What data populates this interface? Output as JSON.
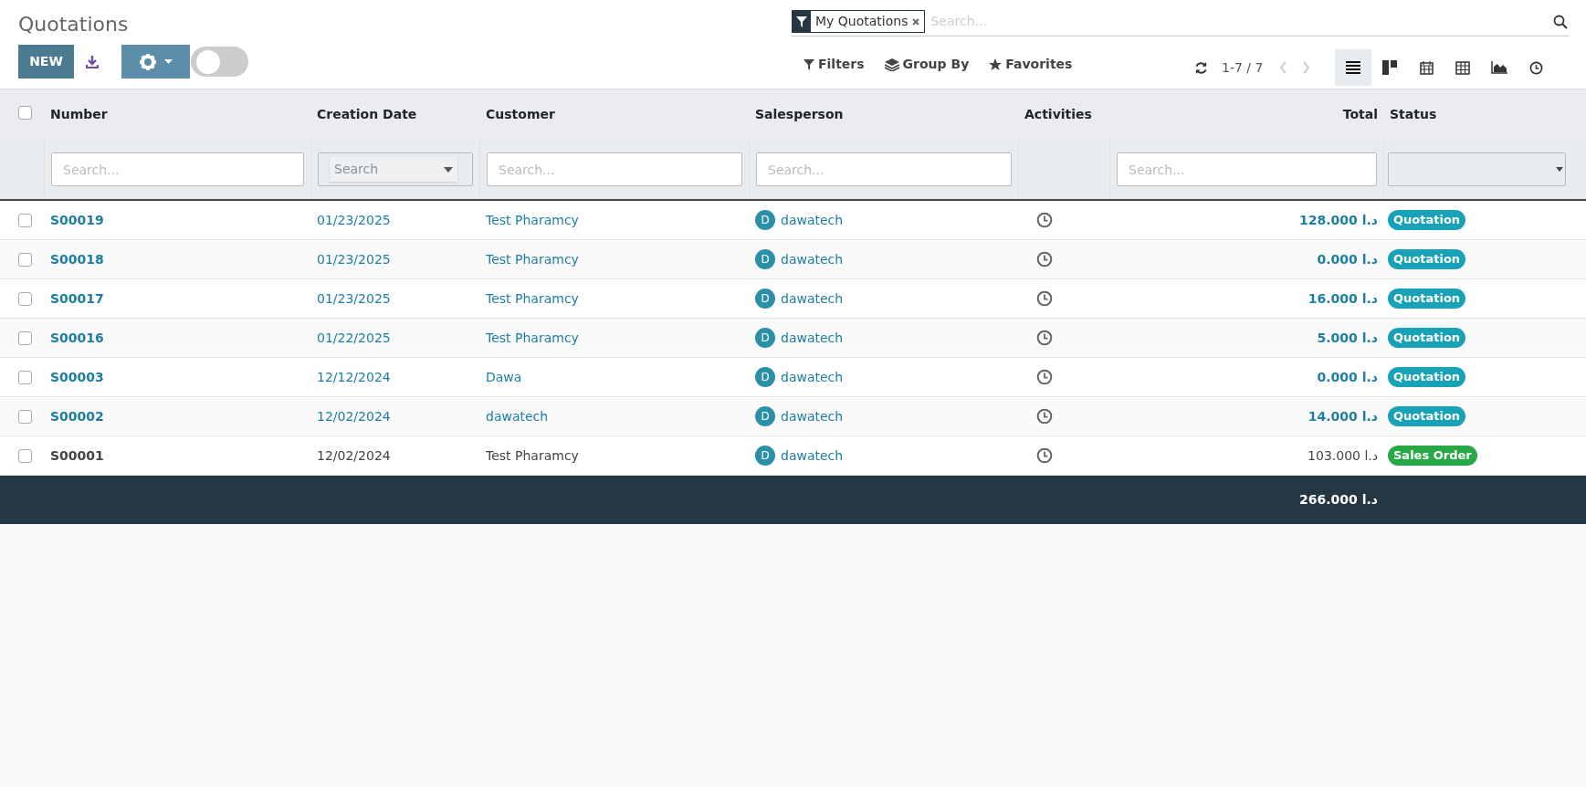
{
  "title": "Quotations",
  "toolbar": {
    "new_button": "NEW",
    "toggle_on": false
  },
  "search": {
    "facet": "My Quotations",
    "placeholder": "Search..."
  },
  "search_options": [
    "Filters",
    "Group By",
    "Favorites"
  ],
  "pager": "1-7 / 7",
  "views": [
    {
      "kind": "list",
      "selected": true
    },
    {
      "kind": "kanban",
      "selected": false
    },
    {
      "kind": "calendar",
      "selected": false
    },
    {
      "kind": "pivot",
      "selected": false
    },
    {
      "kind": "graph",
      "selected": false
    },
    {
      "kind": "activity",
      "selected": false
    }
  ],
  "table": {
    "columns": [
      "Number",
      "Creation Date",
      "Customer",
      "Salesperson",
      "Activities",
      "Total",
      "Status"
    ],
    "all_checked": false,
    "filters": [
      {
        "kind": "text",
        "placeholder": "Search..."
      },
      {
        "kind": "select",
        "placeholder": "Search"
      },
      {
        "kind": "text",
        "placeholder": "Search..."
      },
      {
        "kind": "text",
        "placeholder": "Search..."
      },
      {
        "kind": "none"
      },
      {
        "kind": "text",
        "placeholder": "Search..."
      },
      {
        "kind": "select"
      }
    ],
    "rows": [
      {
        "checked": false,
        "highlighted": true,
        "number": "S00019",
        "date": "01/23/2025",
        "customer": "Test Pharamcy",
        "avatar": "D",
        "salesperson": "dawatech",
        "total": "128.000 د.ا",
        "status": "Quotation",
        "color": "#17a2b8"
      },
      {
        "checked": false,
        "highlighted": true,
        "number": "S00018",
        "date": "01/23/2025",
        "customer": "Test Pharamcy",
        "avatar": "D",
        "salesperson": "dawatech",
        "total": "0.000 د.ا",
        "status": "Quotation",
        "color": "#17a2b8"
      },
      {
        "checked": false,
        "highlighted": true,
        "number": "S00017",
        "date": "01/23/2025",
        "customer": "Test Pharamcy",
        "avatar": "D",
        "salesperson": "dawatech",
        "total": "16.000 د.ا",
        "status": "Quotation",
        "color": "#17a2b8"
      },
      {
        "checked": false,
        "highlighted": true,
        "number": "S00016",
        "date": "01/22/2025",
        "customer": "Test Pharamcy",
        "avatar": "D",
        "salesperson": "dawatech",
        "total": "5.000 د.ا",
        "status": "Quotation",
        "color": "#17a2b8"
      },
      {
        "checked": false,
        "highlighted": true,
        "number": "S00003",
        "date": "12/12/2024",
        "customer": "Dawa",
        "avatar": "D",
        "salesperson": "dawatech",
        "total": "0.000 د.ا",
        "status": "Quotation",
        "color": "#17a2b8"
      },
      {
        "checked": false,
        "highlighted": true,
        "number": "S00002",
        "date": "12/02/2024",
        "customer": "dawatech",
        "avatar": "D",
        "salesperson": "dawatech",
        "total": "14.000 د.ا",
        "status": "Quotation",
        "color": "#17a2b8"
      },
      {
        "checked": false,
        "highlighted": false,
        "number": "S00001",
        "date": "12/02/2024",
        "customer": "Test Pharamcy",
        "avatar": "D",
        "salesperson": "dawatech",
        "total": "103.000 د.ا",
        "status": "Sales Order",
        "color": "#28a745"
      }
    ],
    "footer_total": "266.000 د.ا"
  }
}
